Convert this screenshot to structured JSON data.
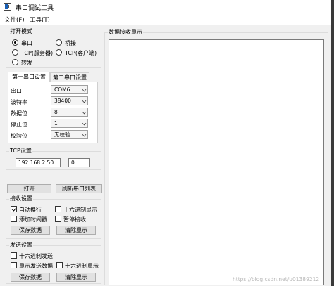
{
  "window": {
    "title": "串口调试工具"
  },
  "menu": {
    "file": "文件(F)",
    "tools": "工具(T)"
  },
  "mode": {
    "title": "打开模式",
    "options": [
      {
        "label": "串口",
        "selected": true
      },
      {
        "label": "桥接",
        "selected": false
      },
      {
        "label": "TCP(服务器)",
        "selected": false
      },
      {
        "label": "TCP(客户端)",
        "selected": false
      },
      {
        "label": "转发",
        "selected": false
      }
    ]
  },
  "serial": {
    "tabs": [
      "第一串口设置",
      "第二串口设置"
    ],
    "fields": [
      {
        "label": "串口",
        "value": "COM6"
      },
      {
        "label": "波特率",
        "value": "38400"
      },
      {
        "label": "数据位",
        "value": "8"
      },
      {
        "label": "停止位",
        "value": "1"
      },
      {
        "label": "校验位",
        "value": "无校验"
      }
    ]
  },
  "tcp": {
    "title": "TCP设置",
    "ip": "192.168.2.50",
    "port": "0"
  },
  "buttons": {
    "open": "打开",
    "refresh": "刷新串口列表"
  },
  "receive": {
    "title": "接收设置",
    "auto_wrap": {
      "label": "自动换行",
      "checked": true
    },
    "hex_display": {
      "label": "十六进制显示",
      "checked": false
    },
    "timestamp": {
      "label": "添加时间戳",
      "checked": false
    },
    "pause": {
      "label": "暂停接收",
      "checked": false
    },
    "save": "保存数据",
    "clear": "清除显示"
  },
  "send": {
    "title": "发送设置",
    "hex_send": {
      "label": "十六进制发送",
      "checked": false
    },
    "show_send": {
      "label": "显示发送数据",
      "checked": false
    },
    "hex_display": {
      "label": "十六进制显示",
      "checked": false
    },
    "save": "保存数据",
    "clear": "清除显示"
  },
  "display": {
    "title": "数据接收显示"
  },
  "watermark": "https://blog.csdn.net/u01389212"
}
